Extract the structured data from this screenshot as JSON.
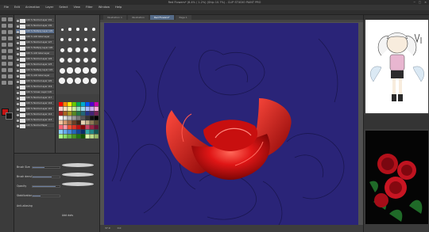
{
  "window": {
    "title": "Red Flowers* (6.4% / 1.2%) (Ship 10.7%) - CLIP STUDIO PAINT PRO",
    "controls": [
      "─",
      "□",
      "✕"
    ]
  },
  "menu": [
    "File",
    "Edit",
    "Animation",
    "Layer",
    "Select",
    "View",
    "Filter",
    "Window",
    "Help"
  ],
  "tabs": [
    "Illustration 1",
    "Illustration",
    "Red Flowers*",
    "Page 1"
  ],
  "active_tab_index": 2,
  "layers": {
    "header": "Layer",
    "items": [
      "100 % Normal Layer 131",
      "100 % Normal Layer 130",
      "100 % Multiply Layer 129",
      "100 % Add Glow Layer 128",
      "100 % Normal Layer 127",
      "100 % Multiply Layer 126",
      "100 % Add Glow Layer 125",
      "100 % Normal Layer 124",
      "100 % Normal Layer 123",
      "100 % Multiply Layer 122",
      "100 % Add Glow Layer 121",
      "100 % Normal Layer 120",
      "100 % Normal Layer 119",
      "100 % Screen Layer 118",
      "100 % Normal Layer 117",
      "100 % Normal Layer 116",
      "100 % Normal Layer 115",
      "100 % Normal Layer 114",
      "100 % Normal Layer 113",
      "100 % Normal Paper"
    ],
    "selected_index": 2
  },
  "brushes": {
    "header": "Brush Size"
  },
  "palette": {
    "header": "Color Set"
  },
  "tool_property": {
    "header": "Tool Property",
    "brush_size_label": "Brush Size",
    "brush_size": 0.45,
    "density_label": "Brush density",
    "density": 0.7,
    "opacity_label": "Opacity",
    "opacity": 0.85,
    "stabilization_label": "Stabilization",
    "stabilization": 0.3,
    "blend_label": "Blending mode",
    "anti_alias_label": "Anti-aliasing",
    "add_label": "Add dots",
    "lock_label": "Lock"
  },
  "status": {
    "zoom": "37.9",
    "angle": "0.0"
  },
  "navigator": {
    "header": "Navigator"
  },
  "colors": {
    "canvas_bg": "#2a2478",
    "rose_red": "#d11515",
    "selection": "#5a6e8c",
    "accent_tab": "#556b88"
  },
  "icons": [
    "pen-icon",
    "brush-icon",
    "eraser-icon",
    "fill-icon",
    "select-icon",
    "move-icon",
    "text-icon",
    "eyedropper-icon",
    "eye-icon",
    "close-icon"
  ]
}
